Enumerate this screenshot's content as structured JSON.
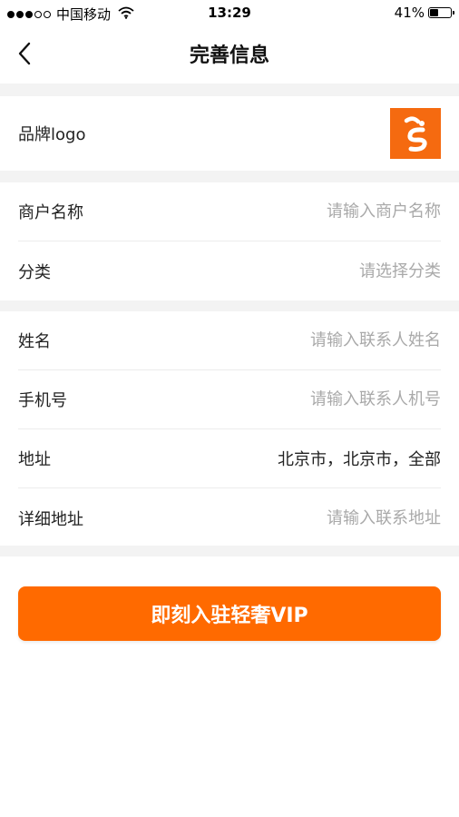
{
  "status_bar": {
    "carrier": "中国移动",
    "time": "13:29",
    "battery_percent": "41%",
    "battery_level": 0.41,
    "signal_bars_filled": 3,
    "signal_bars_total": 5
  },
  "nav": {
    "title": "完善信息"
  },
  "brand": {
    "label": "品牌logo",
    "logo_color": "#f56a10"
  },
  "merchant": {
    "name_label": "商户名称",
    "name_placeholder": "请输入商户名称",
    "category_label": "分类",
    "category_placeholder": "请选择分类"
  },
  "contact": {
    "name_label": "姓名",
    "name_placeholder": "请输入联系人姓名",
    "phone_label": "手机号",
    "phone_placeholder": "请输入联系人机号",
    "address_label": "地址",
    "address_value": "北京市，北京市，全部",
    "detail_label": "详细地址",
    "detail_placeholder": "请输入联系地址"
  },
  "submit": {
    "label": "即刻入驻轻奢VIP",
    "color": "#ff6a00"
  }
}
